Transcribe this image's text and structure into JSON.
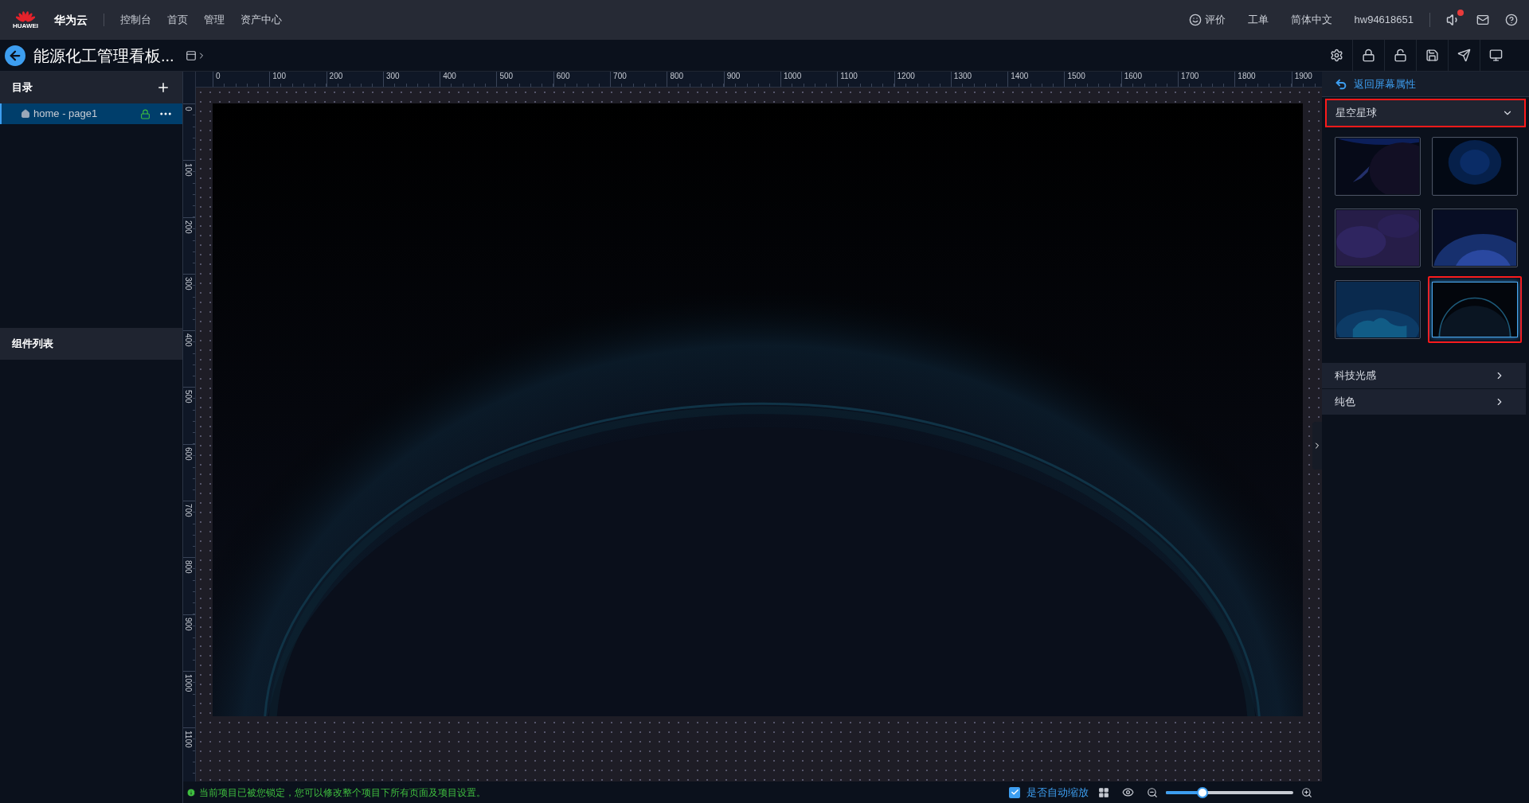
{
  "header": {
    "logo_text": "HUAWEI",
    "brand": "华为云",
    "nav": [
      "控制台",
      "首页",
      "管理",
      "资产中心"
    ],
    "links": [
      "评价",
      "工单",
      "简体中文",
      "hw94618651"
    ],
    "notification_badge": true
  },
  "toolbar": {
    "title": "能源化工管理看板..."
  },
  "sidebar": {
    "catalog_title": "目录",
    "pages": [
      {
        "label": "home - page1",
        "selected": true,
        "locked": true
      }
    ],
    "components_title": "组件列表"
  },
  "rulers": {
    "horizontal": [
      "0",
      "100",
      "200",
      "300",
      "400",
      "500",
      "600",
      "700",
      "800",
      "900",
      "1000",
      "1100",
      "1200",
      "1300",
      "1400",
      "1500",
      "1600",
      "1700",
      "1800",
      "1900"
    ],
    "vertical": [
      "0",
      "100",
      "200",
      "300",
      "400",
      "500",
      "600",
      "700",
      "800",
      "900",
      "1000",
      "1100"
    ]
  },
  "properties": {
    "back_link": "返回屏幕属性",
    "category": "星空星球",
    "thumbnails": [
      {
        "kind": "picture",
        "selected": false
      },
      {
        "kind": "picture",
        "selected": false
      },
      {
        "kind": "picture",
        "selected": false
      },
      {
        "kind": "picture",
        "selected": false
      },
      {
        "kind": "picture",
        "selected": false
      },
      {
        "kind": "picture",
        "selected": true
      }
    ],
    "sections": [
      "科技光感",
      "纯色"
    ]
  },
  "status_bar": {
    "message": "当前项目已被您锁定，您可以修改整个项目下所有页面及项目设置。",
    "auto_scale": {
      "label": "是否自动缩放",
      "checked": true
    },
    "zoom": {
      "level": 0.29
    }
  }
}
